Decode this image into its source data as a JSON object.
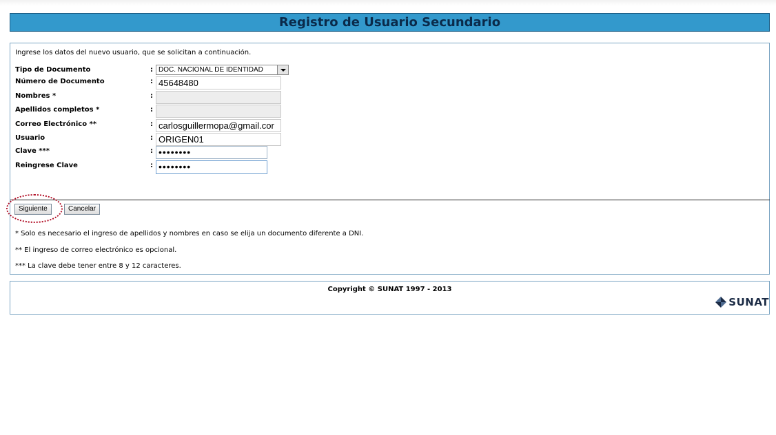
{
  "page": {
    "title": "Registro de Usuario Secundario",
    "intro": "Ingrese los datos del nuevo usuario, que se solicitan a continuación."
  },
  "form": {
    "tipo_documento": {
      "label": "Tipo de Documento",
      "value": "DOC. NACIONAL DE IDENTIDAD"
    },
    "numero_documento": {
      "label": "Número de Documento",
      "value": "45648480"
    },
    "nombres": {
      "label": "Nombres *",
      "value": ""
    },
    "apellidos": {
      "label": "Apellidos completos *",
      "value": ""
    },
    "correo": {
      "label": "Correo Electrónico **",
      "value": "carlosguillermopa@gmail.cor"
    },
    "usuario": {
      "label": "Usuario",
      "value": "ORIGEN01"
    },
    "clave": {
      "label": "Clave ***",
      "value": "••••••••"
    },
    "reingrese_clave": {
      "label": "Reingrese Clave",
      "value": "••••••••"
    },
    "colon": ":"
  },
  "buttons": {
    "siguiente": "Siguiente",
    "cancelar": "Cancelar"
  },
  "notes": [
    "* Solo es necesario el ingreso de apellidos y nombres en caso se elija un documento diferente a DNI.",
    "** El ingreso de correo electrónico es opcional.",
    "*** La clave debe tener entre 8 y 12 caracteres."
  ],
  "footer": {
    "copyright": "Copyright © SUNAT 1997 - 2013",
    "logo_text": "SUNAT"
  },
  "colors": {
    "header": "#3399cc",
    "highlight": "#b3132a",
    "panel_border": "#7aa4c2"
  }
}
